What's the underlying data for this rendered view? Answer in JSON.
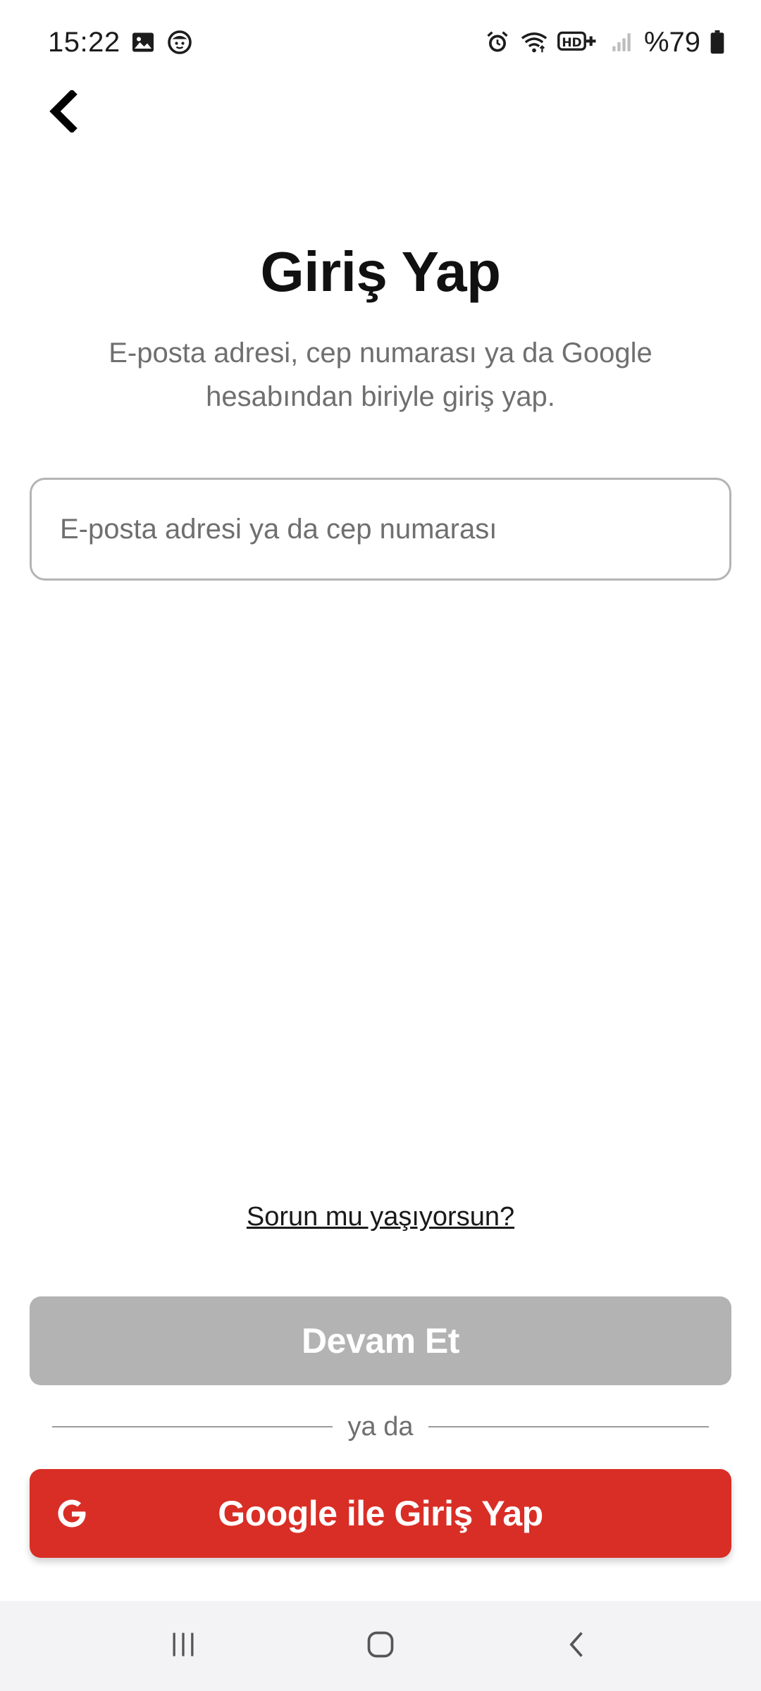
{
  "status_bar": {
    "time": "15:22",
    "battery": "%79",
    "left_icons": [
      "gallery-icon",
      "face-notification-icon"
    ],
    "right_icons": [
      "alarm-icon",
      "wifi-icon",
      "hd-plus-icon",
      "signal-icon",
      "battery-icon"
    ]
  },
  "header": {
    "back_icon": "chevron-left-icon"
  },
  "main": {
    "title": "Giriş Yap",
    "subtitle": "E-posta adresi, cep numarası ya da Google hesabından biriyle giriş yap.",
    "input_placeholder": "E-posta adresi ya da cep numarası",
    "input_value": "",
    "trouble_link": "Sorun mu yaşıyorsun?",
    "continue_label": "Devam Et",
    "divider_text": "ya da",
    "google_label": "Google ile Giriş Yap",
    "google_icon": "google-g-icon"
  },
  "colors": {
    "continue_disabled": "#b3b3b3",
    "google_red": "#d92e26",
    "text_primary": "#111111",
    "text_secondary": "#6f6f6f"
  },
  "nav_bar": {
    "items": [
      "recent-apps-icon",
      "home-icon",
      "back-icon"
    ]
  }
}
